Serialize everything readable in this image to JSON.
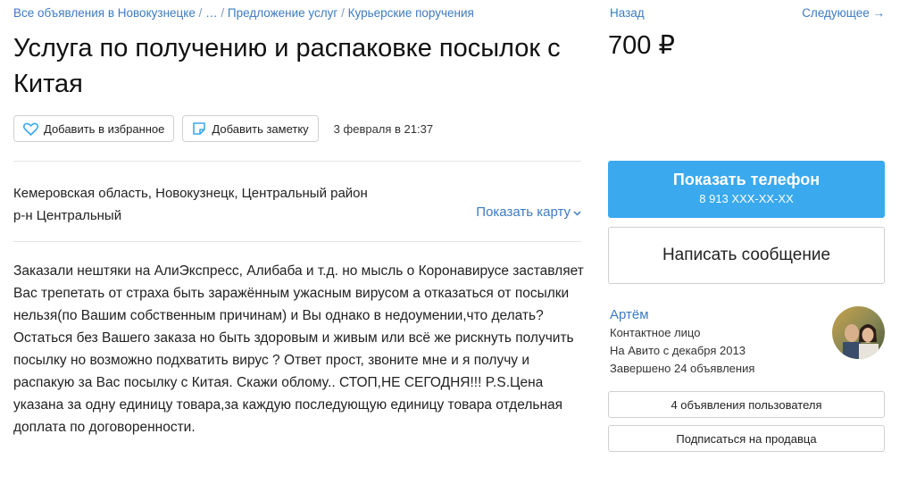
{
  "breadcrumbs": [
    "Все объявления в Новокузнецке",
    "…",
    "Предложение услуг",
    "Курьерские поручения"
  ],
  "breadcrumb_sep": "/",
  "title": "Услуга по получению и распаковке посылок с Китая",
  "actions": {
    "favorite_label": "Добавить в избранное",
    "note_label": "Добавить заметку",
    "posted_date": "3 февраля в 21:37"
  },
  "location": {
    "address": "Кемеровская область, Новокузнецк, Центральный район",
    "district": "р-н Центральный",
    "show_map_label": "Показать карту"
  },
  "description": "Заказали нештяки на АлиЭкспресс, Алибаба и т.д. но мысль о Коронавирусе заставляет Вас трепетать от страха быть заражённым ужасным вирусом а отказаться от посылки нельзя(по Вашим собственным причинам) и Вы однако в недоумении,что делать? Остаться без Вашего заказа но быть здоровым и живым или всё же рискнуть получить посылку но возможно подхватить вирус ? Ответ прост, звоните мне и я получу и распакую за Вас посылку с Китая. Скажи обломy.. СТОП,НЕ СЕГОДНЯ!!! P.S.Цена указана за одну единицу товара,за каждую последующую единицу товара отдельная доплата по договоренности.",
  "nav": {
    "back_label": "Назад",
    "next_label": "Следующее →"
  },
  "price": "700 ₽",
  "phone": {
    "label": "Показать телефон",
    "number": "8 913 XXX-XX-XX"
  },
  "message_label": "Написать сообщение",
  "seller": {
    "name": "Артём",
    "role": "Контактное лицо",
    "since": "На Авито с декабря 2013",
    "completed": "Завершено 24 объявления"
  },
  "user_ads_label": "4 объявления пользователя",
  "subscribe_label": "Подписаться на продавца",
  "colors": {
    "accent": "#3aa9ee",
    "link": "#3c7bc2"
  }
}
